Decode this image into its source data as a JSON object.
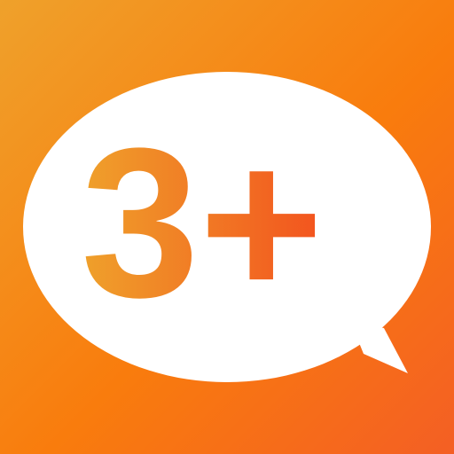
{
  "icon": {
    "label": "3+",
    "colors": {
      "bg_start": "#EFA12B",
      "bg_mid": "#F97C0D",
      "bg_end": "#F45F24",
      "bubble": "#FFFFFF",
      "text_start": "#EFA12B",
      "text_end": "#F3531E"
    }
  }
}
